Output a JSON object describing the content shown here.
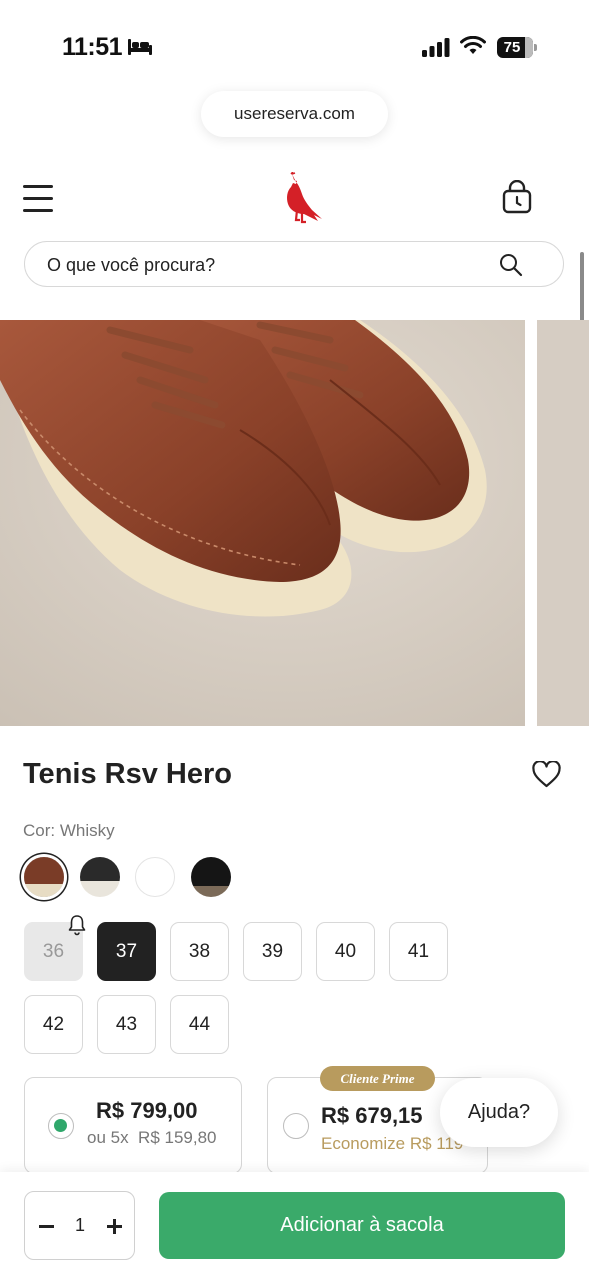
{
  "status_bar": {
    "time": "11:51",
    "battery": "75"
  },
  "browser": {
    "url": "usereserva.com"
  },
  "header": {
    "icons": [
      "menu-icon",
      "reserva-logo",
      "bag-icon"
    ]
  },
  "search": {
    "placeholder": "O que você procura?"
  },
  "product": {
    "title": "Tenis Rsv Hero",
    "color_label": "Cor: Whisky",
    "colors": [
      {
        "name": "whisky",
        "hex": "#6e3a26",
        "selected": true
      },
      {
        "name": "black-white",
        "hex": "#2c2c2c"
      },
      {
        "name": "white",
        "hex": "#ffffff"
      },
      {
        "name": "black",
        "hex": "#1a1a1a"
      }
    ],
    "sizes": [
      {
        "label": "36",
        "state": "unavailable"
      },
      {
        "label": "37",
        "state": "selected"
      },
      {
        "label": "38",
        "state": "available"
      },
      {
        "label": "39",
        "state": "available"
      },
      {
        "label": "40",
        "state": "available"
      },
      {
        "label": "41",
        "state": "available"
      },
      {
        "label": "42",
        "state": "available"
      },
      {
        "label": "43",
        "state": "available"
      },
      {
        "label": "44",
        "state": "available"
      }
    ]
  },
  "pricing": {
    "regular": {
      "price": "R$ 799,00",
      "installments_prefix": "ou 5x",
      "installment_value": "R$ 159,80",
      "selected": true
    },
    "prime": {
      "badge": "Cliente Prime",
      "price": "R$ 679,15",
      "economy": "Economize R$ 119"
    }
  },
  "help": {
    "label": "Ajuda?"
  },
  "cart": {
    "quantity": "1",
    "add_label": "Adicionar à sacola",
    "accent": "#3aaa6a"
  }
}
